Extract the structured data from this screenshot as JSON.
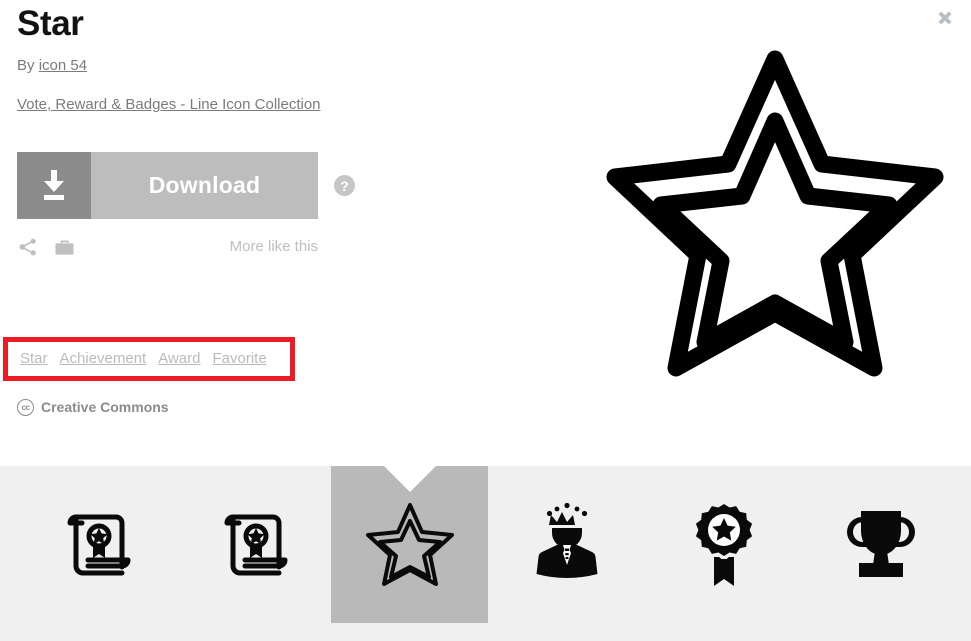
{
  "window": {
    "close_label": "×"
  },
  "detail": {
    "title": "Star",
    "by_prefix": "By ",
    "author": "icon 54",
    "collection": "Vote, Reward & Badges - Line Icon Collection",
    "download_label": "Download",
    "help_label": "?",
    "more_like_this": "More like this",
    "license_label": "Creative Commons",
    "license_badge": "cc"
  },
  "tags": [
    {
      "label": "Star"
    },
    {
      "label": "Achievement"
    },
    {
      "label": "Award"
    },
    {
      "label": "Favorite"
    }
  ],
  "highlight": {
    "color": "#ed1c24",
    "target": "tags-row"
  },
  "preview": {
    "icon_name": "star-double-outline-icon",
    "alt": "Star"
  },
  "thumbnails": [
    {
      "icon_name": "certificate-scroll-icon",
      "label": "Certificate",
      "selected": false
    },
    {
      "icon_name": "certificate-scroll-icon",
      "label": "Diploma",
      "selected": false
    },
    {
      "icon_name": "star-outline-icon",
      "label": "Star",
      "selected": true
    },
    {
      "icon_name": "king-person-icon",
      "label": "King",
      "selected": false
    },
    {
      "icon_name": "award-rosette-icon",
      "label": "Award",
      "selected": false
    },
    {
      "icon_name": "trophy-icon",
      "label": "Trophy",
      "selected": false
    }
  ],
  "colors": {
    "download_icon_bg": "#8c8c8c",
    "download_label_bg": "#bdbdbd",
    "strip_bg": "#f0f0f0",
    "thumb_selected_bg": "#b9b9b9",
    "muted_text": "#7b7b7b",
    "tag_text": "#bbbbbb"
  }
}
